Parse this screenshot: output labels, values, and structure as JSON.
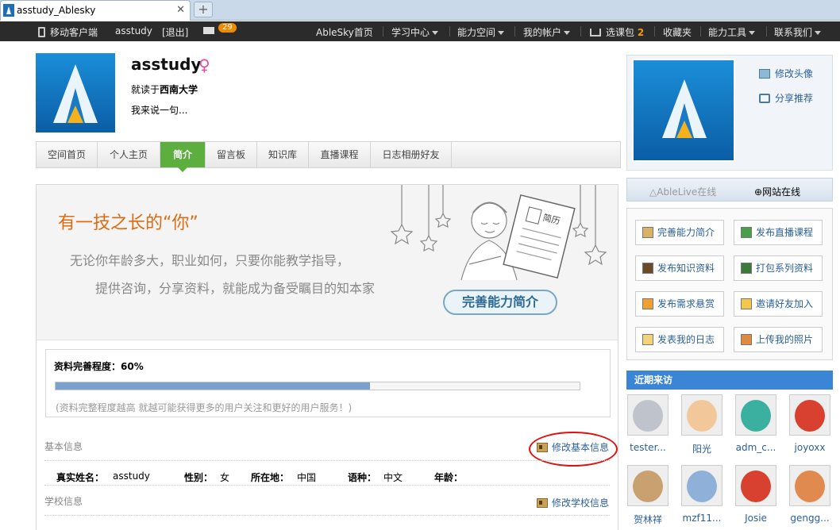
{
  "browser": {
    "tab_title": "asstudy_Ablesky",
    "close": "✕",
    "new_tab": "+"
  },
  "topbar": {
    "mobile": "移动客户端",
    "user": "asstudy",
    "logout": "[退出]",
    "mail_count": "29",
    "home": "AbleSky首页",
    "learning": "学习中心",
    "space": "能力空间",
    "account": "我的帐户",
    "cart": "选课包",
    "cart_count": "2",
    "favorites": "收藏夹",
    "tools": "能力工具",
    "contact": "联系我们"
  },
  "profile": {
    "name": "asstudy",
    "gender_symbol": "♀",
    "school_prefix": "就读于",
    "school": "西南大学",
    "motto": "我来说一句..."
  },
  "tabs": [
    {
      "label": "空间首页"
    },
    {
      "label": "个人主页"
    },
    {
      "label": "简介",
      "active": true
    },
    {
      "label": "留言板"
    },
    {
      "label": "知识库"
    },
    {
      "label": "直播课程"
    },
    {
      "label": "日志相册好友"
    }
  ],
  "banner": {
    "title": "有一技之长的“你”",
    "line1": "无论你年龄多大，职业如何，只要你能教学指导，",
    "line2": "提供咨询，分享资料，就能成为备受瞩目的知本家",
    "button": "完善能力简介",
    "resume_label": "简历"
  },
  "progress": {
    "label": "资料完善程度：60%",
    "percent": 60,
    "hint": "(资料完整程度越高 就越可能获得更多的用户关注和更好的用户服务！)"
  },
  "basic_info": {
    "title": "基本信息",
    "edit": "修改基本信息",
    "fields": [
      {
        "label": "真实姓名：",
        "value": "asstudy"
      },
      {
        "label": "性别：",
        "value": "女"
      },
      {
        "label": "所在地：",
        "value": "中国"
      },
      {
        "label": "语种：",
        "value": "中文"
      },
      {
        "label": "年龄：",
        "value": ""
      }
    ]
  },
  "school_info": {
    "title": "学校信息",
    "edit": "修改学校信息"
  },
  "sidebar": {
    "change_avatar": "修改头像",
    "share": "分享推荐",
    "ablelive_status": "AbleLive在线",
    "web_status": "网站在线",
    "actions": [
      "完善能力简介",
      "发布直播课程",
      "发布知识资料",
      "打包系列资料",
      "发布需求悬赏",
      "邀请好友加入",
      "发表我的日志",
      "上传我的照片"
    ],
    "visitors_title": "近期来访",
    "visitors": [
      "tester...",
      "阳光",
      "adm_c...",
      "joyoxx",
      "贺林祥",
      "mzf11...",
      "Josie",
      "gengg..."
    ]
  },
  "colors": {
    "accent_green": "#5cae3e",
    "link_blue": "#2a5f9a",
    "title_orange": "#e06a10",
    "header_blue": "#3a85d6"
  }
}
